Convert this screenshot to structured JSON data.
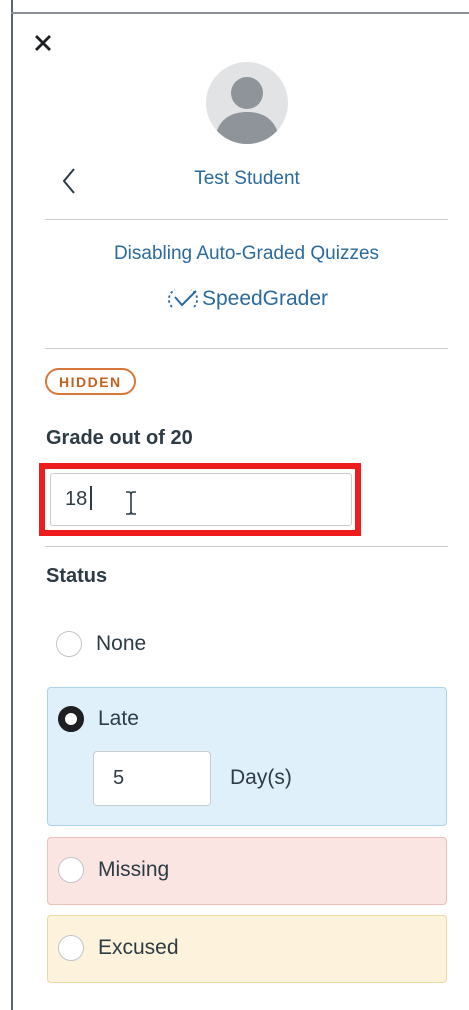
{
  "header": {
    "close_icon": "close-icon",
    "back_icon": "chevron-left-icon",
    "student_name": "Test Student"
  },
  "assignment": {
    "title": "Disabling Auto-Graded Quizzes",
    "speedgrader_label": "SpeedGrader",
    "speedgrader_icon": "speedgrader-icon"
  },
  "visibility_badge": "HIDDEN",
  "grade": {
    "label": "Grade out of 20",
    "value": "18"
  },
  "status": {
    "label": "Status",
    "options": [
      {
        "label": "None",
        "selected": false
      },
      {
        "label": "Late",
        "selected": true
      },
      {
        "label": "Missing",
        "selected": false
      },
      {
        "label": "Excused",
        "selected": false
      }
    ],
    "late_days_value": "5",
    "late_days_unit": "Day(s)"
  },
  "colors": {
    "link": "#2b6a9e",
    "badge": "#d9763a",
    "highlight": "#ee1c1c",
    "late_bg": "#e0f0fa",
    "missing_bg": "#fbe5e2",
    "excused_bg": "#fdf3dc"
  }
}
